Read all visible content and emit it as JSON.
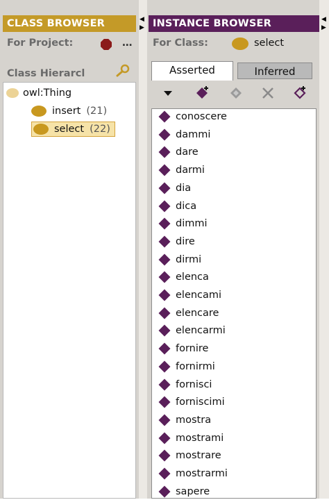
{
  "class_browser": {
    "title": "CLASS BROWSER",
    "for_project_label": "For Project:",
    "project_ellipsis": "…",
    "hierarchy_label": "Class Hierarcl",
    "root": {
      "label": "owl:Thing"
    },
    "classes": [
      {
        "name": "insert",
        "count": "(21)",
        "selected": false
      },
      {
        "name": "select",
        "count": "(22)",
        "selected": true
      }
    ]
  },
  "instance_browser": {
    "title": "INSTANCE BROWSER",
    "for_class_label": "For Class:",
    "for_class_value": "select",
    "tabs": [
      {
        "label": "Asserted",
        "active": true
      },
      {
        "label": "Inferred",
        "active": false
      }
    ],
    "toolbar": [
      "dropdown-arrow-icon",
      "create-instance-icon",
      "copy-instance-icon",
      "delete-instance-icon",
      "instance-settings-icon"
    ],
    "instances": [
      "conoscere",
      "dammi",
      "dare",
      "darmi",
      "dia",
      "dica",
      "dimmi",
      "dire",
      "dirmi",
      "elenca",
      "elencami",
      "elencare",
      "elencarmi",
      "fornire",
      "fornirmi",
      "fornisci",
      "forniscimi",
      "mostra",
      "mostrami",
      "mostrare",
      "mostrarmi",
      "sapere"
    ]
  },
  "colors": {
    "class_header": "#c49a28",
    "instance_header": "#5a1f5a",
    "class_ball": "#c8981f",
    "project_icon": "#8b1a1a",
    "instance_diamond": "#5a1f5a"
  }
}
